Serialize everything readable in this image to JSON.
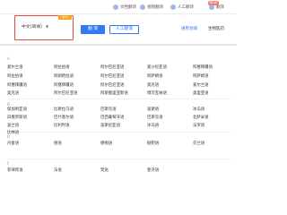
{
  "nav": {
    "items": [
      {
        "label": "文档翻译"
      },
      {
        "label": "视频翻译"
      },
      {
        "label": "人工翻译"
      }
    ],
    "badge": "NEW",
    "last_item": "翻译"
  },
  "toolbar": {
    "lang_value": "中文(简体)",
    "new_tag": "NEW",
    "translate_label": "翻 译",
    "human_label": "人工翻译",
    "field_label": "通用领域",
    "field_value": "生物医药"
  },
  "sections": [
    {
      "label": "A"
    },
    {
      "label": "B"
    },
    {
      "label": "D"
    },
    {
      "label": "F"
    }
  ],
  "languages": {
    "col1": [
      "爱尔兰语",
      "阿拉伯语",
      "阿塞拜疆语",
      "奥克语",
      "保加利亚语",
      "白俄罗斯语",
      "波兰语",
      "比林语",
      "丹麦语",
      "菲律宾语"
    ],
    "col2": [
      "阿拉伯语",
      "阿姆哈拉语",
      "阿塞拜疆语",
      "阿尔巴尼亚语",
      "比斯拉马语",
      "巴什基尔语",
      "比利时语",
      "德语",
      "法语"
    ],
    "col3": [
      "阿尔巴尼亚语",
      "阿尔巴尼亚语",
      "阿尔巴尼亚语",
      "阿斯图里亚斯语",
      "巴斯克语",
      "巴西葡萄牙语",
      "波斯尼亚语",
      "德顿语",
      "梵语"
    ],
    "col4": [
      "爱沙尼亚语",
      "阿萨姆语",
      "奥克语",
      "博茨瓦纳语",
      "波斯语",
      "巴斯克语",
      "冰岛语",
      "鞑靼语",
      "斐济语"
    ],
    "col5": [
      "阿塞拜疆语",
      "阿萨姆语",
      "爱尔兰语",
      "奥里亚语",
      "冰岛语",
      "北萨米语",
      "法罗语",
      "芬兰语"
    ]
  }
}
